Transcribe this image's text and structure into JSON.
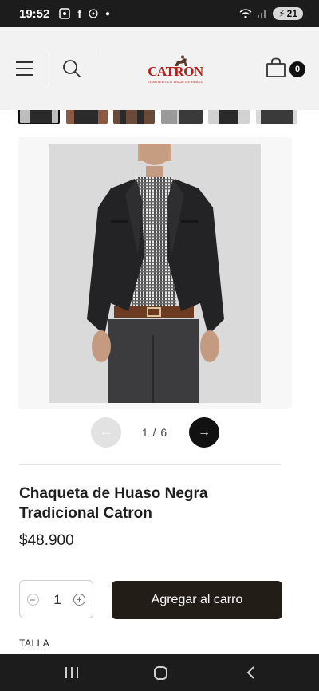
{
  "status_bar": {
    "time": "19:52",
    "battery": "21"
  },
  "header": {
    "logo": {
      "brand": "CATRON",
      "tagline": "EL AUTENTICO TRAJE DE HUASO"
    },
    "cart_count": "0"
  },
  "gallery": {
    "counter": "1 / 6",
    "prev_arrow": "←",
    "next_arrow": "→",
    "thumbnails": 6
  },
  "product": {
    "title": "Chaqueta de Huaso Negra Tradicional Catron",
    "price": "$48.900",
    "quantity": "1",
    "add_to_cart_label": "Agregar al carro",
    "size_label": "TALLA"
  },
  "colors": {
    "brand_red": "#b3201c",
    "button_dark": "#221d17"
  }
}
